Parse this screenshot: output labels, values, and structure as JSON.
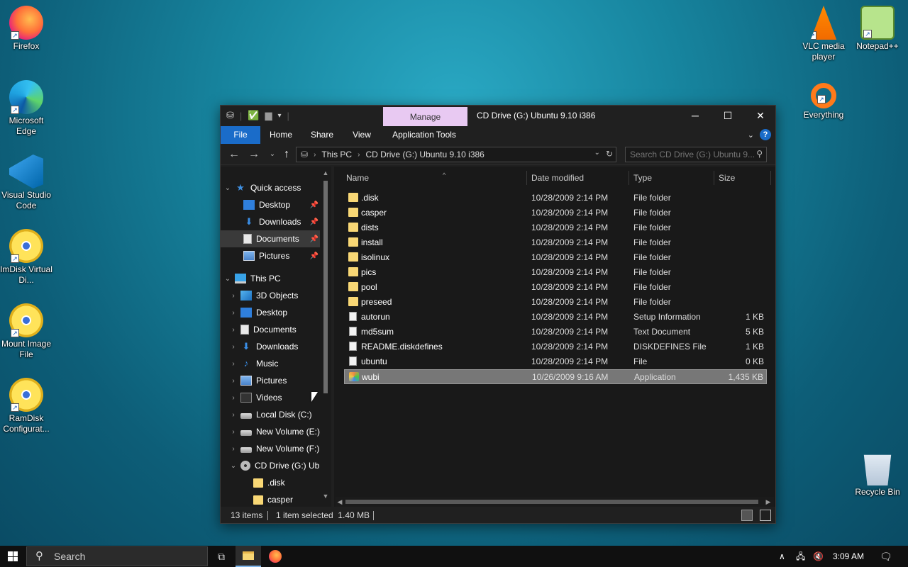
{
  "desktop": {
    "icons_left": [
      {
        "label": "Firefox",
        "icon": "firefox-icon"
      },
      {
        "label": "Microsoft Edge",
        "icon": "edge-icon"
      },
      {
        "label": "Visual Studio Code",
        "icon": "vscode-icon"
      },
      {
        "label": "ImDisk Virtual Di...",
        "icon": "imdisk-icon"
      },
      {
        "label": "Mount Image File",
        "icon": "mount-icon"
      },
      {
        "label": "RamDisk Configurat...",
        "icon": "ramdisk-icon"
      }
    ],
    "icons_right": [
      {
        "label": "VLC media player",
        "icon": "vlc-icon"
      },
      {
        "label": "Notepad++",
        "icon": "notepadpp-icon"
      },
      {
        "label": "Everything",
        "icon": "everything-icon"
      },
      {
        "label": "Recycle Bin",
        "icon": "recycle-bin-icon"
      }
    ]
  },
  "window": {
    "title": "CD Drive (G:) Ubuntu 9.10 i386",
    "manage_tab": "Manage",
    "controls": {
      "minimize": "─",
      "maximize": "☐",
      "close": "✕"
    },
    "ribbon_tabs": [
      "File",
      "Home",
      "Share",
      "View",
      "Application Tools"
    ],
    "address": {
      "crumbs": [
        "This PC",
        "CD Drive (G:) Ubuntu 9.10 i386"
      ]
    },
    "search_placeholder": "Search CD Drive (G:) Ubuntu 9...",
    "nav": {
      "quick_access": "Quick access",
      "quick_items": [
        "Desktop",
        "Downloads",
        "Documents",
        "Pictures"
      ],
      "this_pc": "This PC",
      "pc_items": [
        "3D Objects",
        "Desktop",
        "Documents",
        "Downloads",
        "Music",
        "Pictures",
        "Videos",
        "Local Disk (C:)",
        "New Volume (E:)",
        "New Volume (F:)",
        "CD Drive (G:) Ub"
      ],
      "cd_children": [
        ".disk",
        "casper"
      ]
    },
    "columns": {
      "name": "Name",
      "date": "Date modified",
      "type": "Type",
      "size": "Size"
    },
    "files": [
      {
        "name": ".disk",
        "date": "10/28/2009 2:14 PM",
        "type": "File folder",
        "size": "",
        "kind": "folder"
      },
      {
        "name": "casper",
        "date": "10/28/2009 2:14 PM",
        "type": "File folder",
        "size": "",
        "kind": "folder"
      },
      {
        "name": "dists",
        "date": "10/28/2009 2:14 PM",
        "type": "File folder",
        "size": "",
        "kind": "folder"
      },
      {
        "name": "install",
        "date": "10/28/2009 2:14 PM",
        "type": "File folder",
        "size": "",
        "kind": "folder"
      },
      {
        "name": "isolinux",
        "date": "10/28/2009 2:14 PM",
        "type": "File folder",
        "size": "",
        "kind": "folder"
      },
      {
        "name": "pics",
        "date": "10/28/2009 2:14 PM",
        "type": "File folder",
        "size": "",
        "kind": "folder"
      },
      {
        "name": "pool",
        "date": "10/28/2009 2:14 PM",
        "type": "File folder",
        "size": "",
        "kind": "folder"
      },
      {
        "name": "preseed",
        "date": "10/28/2009 2:14 PM",
        "type": "File folder",
        "size": "",
        "kind": "folder"
      },
      {
        "name": "autorun",
        "date": "10/28/2009 2:14 PM",
        "type": "Setup Information",
        "size": "1 KB",
        "kind": "inf"
      },
      {
        "name": "md5sum",
        "date": "10/28/2009 2:14 PM",
        "type": "Text Document",
        "size": "5 KB",
        "kind": "file"
      },
      {
        "name": "README.diskdefines",
        "date": "10/28/2009 2:14 PM",
        "type": "DISKDEFINES File",
        "size": "1 KB",
        "kind": "file"
      },
      {
        "name": "ubuntu",
        "date": "10/28/2009 2:14 PM",
        "type": "File",
        "size": "0 KB",
        "kind": "file"
      },
      {
        "name": "wubi",
        "date": "10/26/2009 9:16 AM",
        "type": "Application",
        "size": "1,435 KB",
        "kind": "app",
        "selected": true
      }
    ],
    "status": {
      "items": "13 items",
      "selected": "1 item selected  1.40 MB"
    }
  },
  "taskbar": {
    "search_placeholder": "Search",
    "clock": "3:09 AM"
  }
}
